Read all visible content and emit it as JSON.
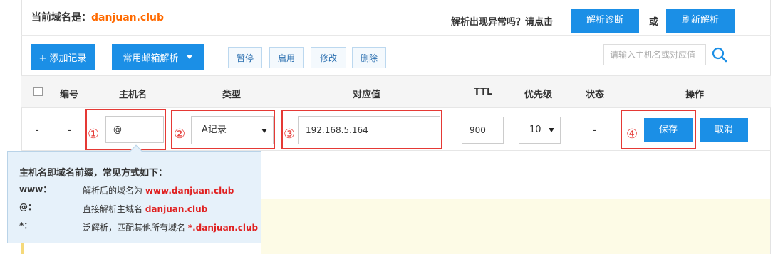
{
  "header": {
    "domain_prefix": "当前域名是：",
    "domain_name": "danjuan.club",
    "hint": "解析出现异常吗？请点击",
    "diagnose_button": "解析诊断",
    "or": "或",
    "refresh_button": "刷新解析"
  },
  "toolbar": {
    "add_record": "+ 添加记录",
    "mail_resolve": "常用邮箱解析",
    "pause": "暂停",
    "enable": "启用",
    "modify": "修改",
    "delete": "删除",
    "search_placeholder": "请输入主机名或对应值"
  },
  "table": {
    "headers": [
      "编号",
      "主机名",
      "类型",
      "对应值",
      "TTL",
      "优先级",
      "状态",
      "操作"
    ]
  },
  "row": {
    "dash": "-",
    "host_value": "@",
    "type_value": "A记录",
    "record_value": "192.168.5.164",
    "ttl_value": "900",
    "priority_value": "10",
    "status_value": "-",
    "save_button": "保存",
    "cancel_button": "取消"
  },
  "annotations": [
    "①",
    "②",
    "③",
    "④"
  ],
  "tooltip": {
    "title": "主机名即域名前缀，常见方式如下：",
    "items": [
      {
        "key": "www：",
        "desc": "解析后的域名为",
        "value": "www.danjuan.club"
      },
      {
        "key": "@：",
        "desc": "直接解析主域名",
        "value": "danjuan.club"
      },
      {
        "key": "*：",
        "desc": "泛解析，匹配其他所有域名",
        "value": "*.danjuan.club"
      }
    ]
  },
  "colors": {
    "primary": "#1b8fe6",
    "accent_orange": "#ff6a00",
    "annotation_red": "#e53935",
    "highlight_red": "#e02020"
  }
}
